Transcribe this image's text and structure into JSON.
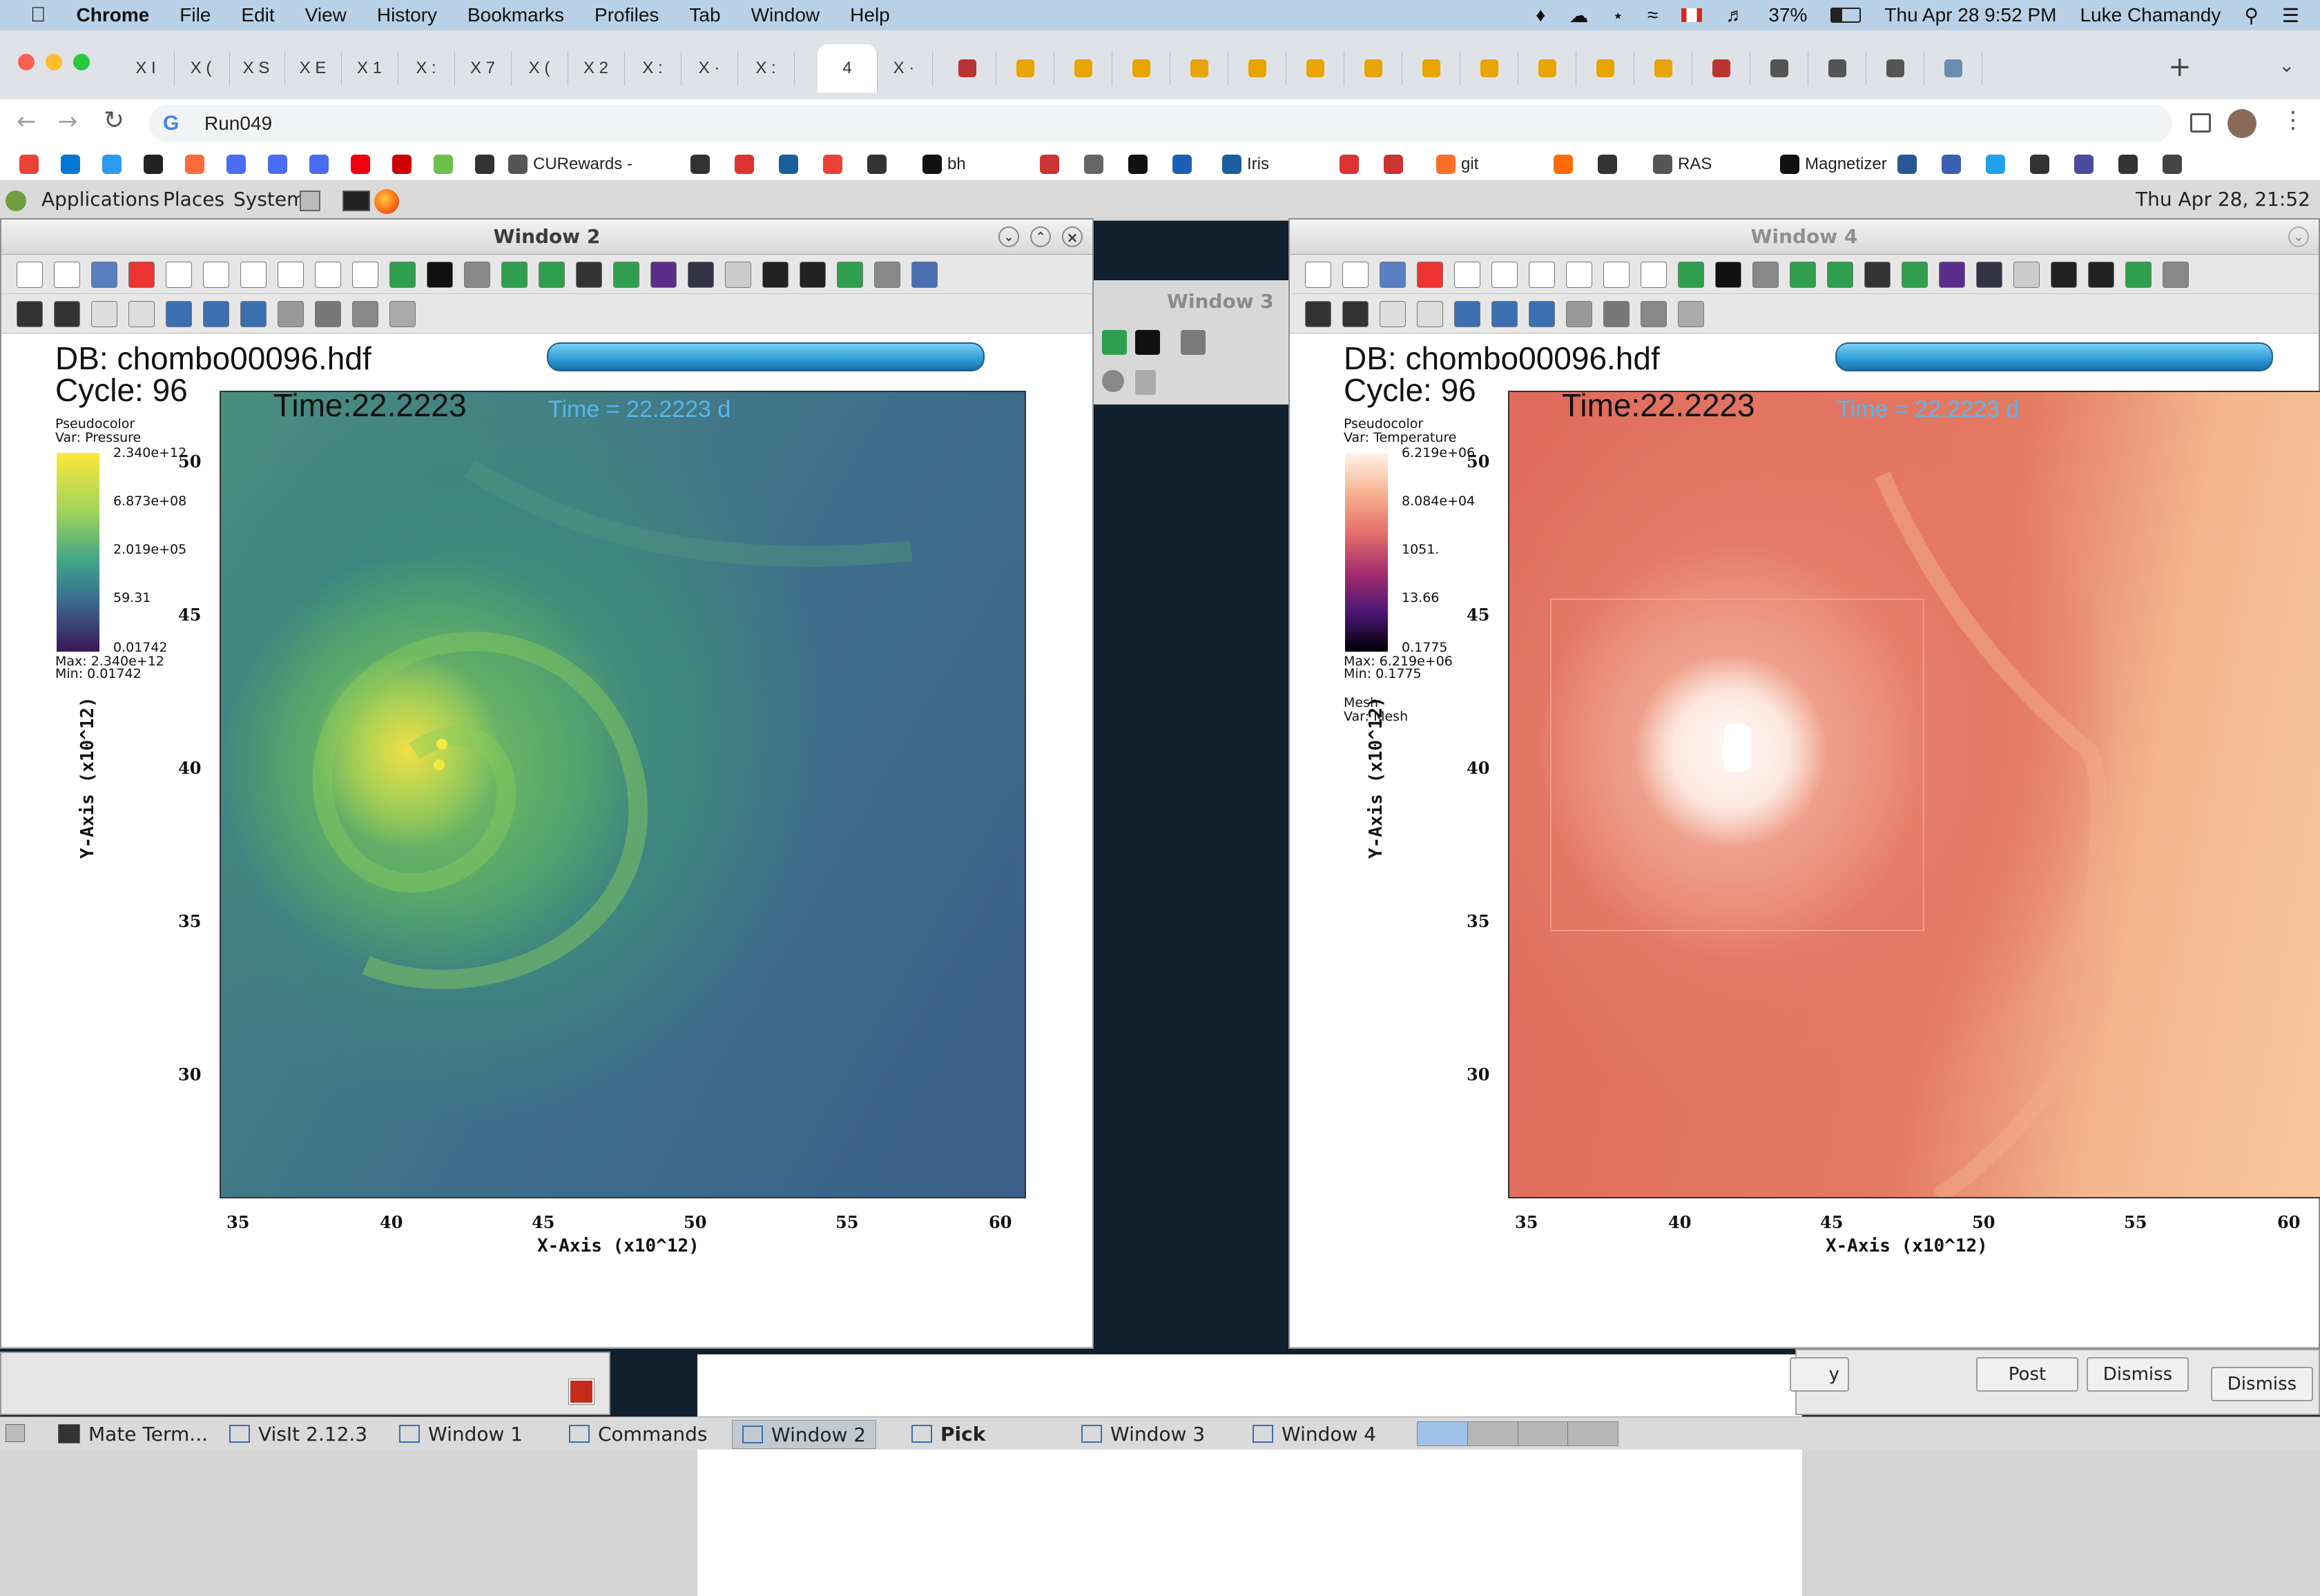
{
  "menubar": {
    "app": "Chrome",
    "items": [
      "File",
      "Edit",
      "View",
      "History",
      "Bookmarks",
      "Profiles",
      "Tab",
      "Window",
      "Help"
    ],
    "battery": "37%",
    "clock": "Thu Apr 28  9:52 PM",
    "user": "Luke Chamandy"
  },
  "tabs": [
    "X I",
    "X (",
    "X S",
    "X E",
    "X 1",
    "X :",
    "X 7",
    "X (",
    "X 2",
    "X :",
    "X ·",
    "X :",
    "4",
    "X ·"
  ],
  "address": {
    "url": "Run049"
  },
  "bookmarks": [
    "CURewards -",
    "bh",
    "Iris",
    "git",
    "RAS",
    "Magnetizer"
  ],
  "gnome_panel": {
    "items": [
      "Applications",
      "Places",
      "System"
    ],
    "clock": "Thu Apr 28, 21:52"
  },
  "window2": {
    "title": "Window 2",
    "db": "DB: chombo00096.hdf",
    "cycle": "Cycle: 96",
    "time": "Time:22.2223",
    "time_annot": "Time = 22.2223 d",
    "legend": {
      "title1": "Pseudocolor",
      "title2": "Var: Pressure",
      "ticks": [
        "2.340e+12",
        "6.873e+08",
        "2.019e+05",
        "59.31",
        "0.01742"
      ],
      "max": "Max: 2.340e+12",
      "min": "Min: 0.01742"
    },
    "xlabel": "X-Axis (x10^12)",
    "ylabel": "Y-Axis (x10^12)",
    "xticks": [
      "35",
      "40",
      "45",
      "50",
      "55",
      "60"
    ],
    "yticks": [
      "50",
      "45",
      "40",
      "35",
      "30"
    ]
  },
  "window3": {
    "title": "Window 3"
  },
  "window4": {
    "title": "Window 4",
    "db": "DB: chombo00096.hdf",
    "cycle": "Cycle: 96",
    "time": "Time:22.2223",
    "time_annot": "Time = 22.2223 d",
    "legend": {
      "title1": "Pseudocolor",
      "title2": "Var: Temperature",
      "ticks": [
        "6.219e+06",
        "8.084e+04",
        "1051.",
        "13.66",
        "0.1775"
      ],
      "max": "Max: 6.219e+06",
      "min": "Min: 0.1775",
      "mesh1": "Mesh",
      "mesh2": "Var: Mesh"
    },
    "xlabel": "X-Axis (x10^12)",
    "ylabel": "Y-Axis (x10^12)",
    "xticks": [
      "35",
      "40",
      "45",
      "50",
      "55",
      "60"
    ],
    "yticks": [
      "50",
      "45",
      "40",
      "35",
      "30"
    ]
  },
  "dialog": {
    "post": "Post",
    "dismiss": "Dismiss",
    "dismiss2": "Dismiss",
    "partial": "y"
  },
  "taskbar": [
    "Mate Term...",
    "VisIt 2.12.3",
    "Window 1",
    "Commands",
    "Window 2",
    "Pick",
    "Window 3",
    "Window 4"
  ],
  "colors": {
    "pressure_low": "#3a5f8a",
    "pressure_high": "#f4e34a",
    "temperature_bg": "#e06a5c",
    "temperature_hot": "#fff4f0",
    "accent_blue": "#2c9ad6"
  }
}
